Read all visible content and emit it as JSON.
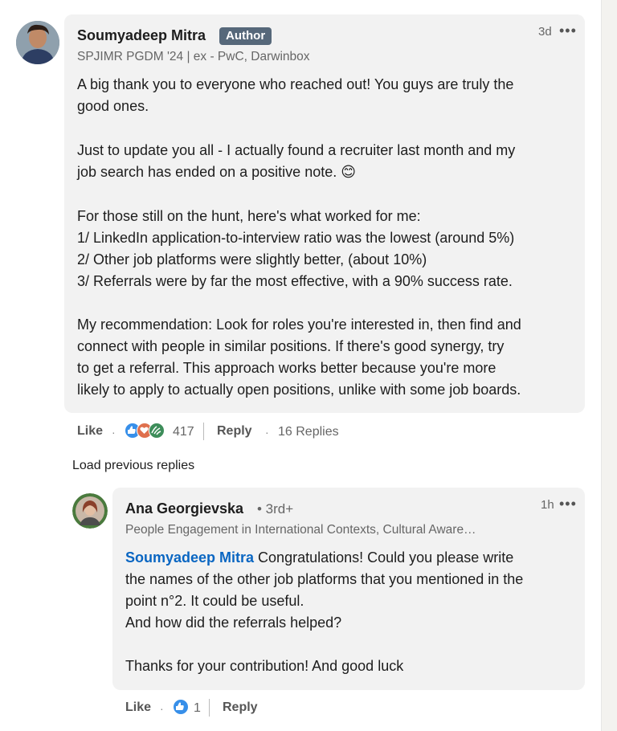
{
  "colors": {
    "link": "#0a66c2",
    "badge_bg": "#56687a",
    "bubble_bg": "#f2f2f2"
  },
  "comment": {
    "author": "Soumyadeep Mitra",
    "badge": "Author",
    "headline": "SPJIMR PGDM '24 | ex - PwC, Darwinbox",
    "time": "3d",
    "menu_icon": "more-horizontal-icon",
    "paragraph1": "A big thank you to everyone who reached out! You guys are truly the\ngood ones.",
    "paragraph2": "Just to update you all - I actually found a recruiter last month and my\njob search has ended on a positive note. 😊",
    "paragraph3": "For those still on the hunt, here's what worked for me:\n1/ LinkedIn application-to-interview ratio was the lowest (around 5%)\n2/ Other job platforms were slightly better, (about 10%)\n3/ Referrals were by far the most effective, with a 90% success rate.",
    "paragraph4": "My recommendation: Look for roles you're interested in, then find and\nconnect with people in similar positions. If there's good synergy, try\nto get a referral. This approach works better because you're more\nlikely to apply to actually open positions, unlike with some job boards.",
    "like_label": "Like",
    "reaction_icons": [
      "like-icon",
      "love-icon",
      "support-icon"
    ],
    "reaction_count": "417",
    "reply_label": "Reply",
    "replies_count": "16 Replies"
  },
  "load_previous": "Load previous replies",
  "reply": {
    "author": "Ana Georgievska",
    "degree": "• 3rd+",
    "headline": "People Engagement in International Contexts, Cultural Aware…",
    "time": "1h",
    "mention": "Soumyadeep Mitra",
    "text_after_mention": " Congratulations! Could you please write\nthe names of the other job platforms that you mentioned in the\npoint n°2. It could be useful.\nAnd how did the referrals helped?\n\nThanks for your contribution! And good luck",
    "like_label": "Like",
    "reaction_icons": [
      "like-icon"
    ],
    "reaction_count": "1",
    "reply_label": "Reply"
  }
}
